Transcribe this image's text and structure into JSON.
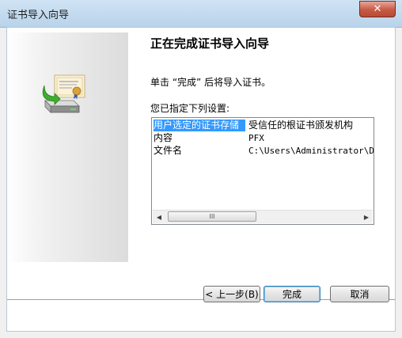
{
  "window": {
    "title": "证书导入向导",
    "close_symbol": "✕"
  },
  "main": {
    "heading": "正在完成证书导入向导",
    "instruction": "单击 “完成” 后将导入证书。",
    "settings_label": "您已指定下列设置:",
    "settings_rows": [
      {
        "name": "用户选定的证书存储",
        "value": "受信任的根证书颁发机构"
      },
      {
        "name": "内容",
        "value": "PFX"
      },
      {
        "name": "文件名",
        "value": "C:\\Users\\Administrator\\Desk"
      }
    ],
    "scrollbar": {
      "left_arrow": "◀",
      "right_arrow": "▶",
      "thumb_grip": "III"
    }
  },
  "buttons": {
    "back": "< 上一步(B)",
    "finish": "完成",
    "cancel": "取消"
  },
  "icons": {
    "wizard": "certificate-install-icon",
    "close": "close-icon"
  },
  "colors": {
    "selection": "#3399ff",
    "titlebar": "#c4dbef",
    "close_button": "#c75a45"
  }
}
